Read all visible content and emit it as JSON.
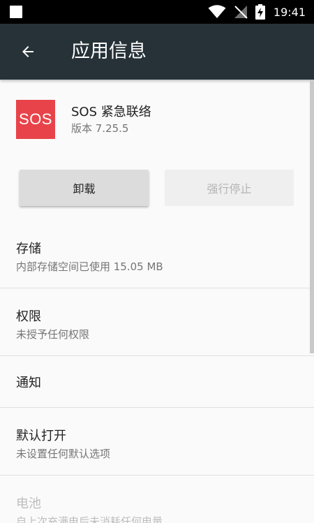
{
  "status_bar": {
    "time": "19:41"
  },
  "app_bar": {
    "title": "应用信息"
  },
  "app": {
    "icon_text": "SOS",
    "name": "SOS 紧急联络",
    "version": "版本 7.25.5",
    "icon_color": "#e8434a"
  },
  "actions": {
    "uninstall_label": "卸载",
    "force_stop_label": "强行停止"
  },
  "settings": [
    {
      "title": "存储",
      "subtitle": "内部存储空间已使用 15.05 MB"
    },
    {
      "title": "权限",
      "subtitle": "未授予任何权限"
    },
    {
      "title": "通知"
    },
    {
      "title": "默认打开",
      "subtitle": "未设置任何默认选项"
    },
    {
      "title": "电池",
      "subtitle": "自上次充满电后未消耗任何电量"
    }
  ],
  "colors": {
    "app_bar": "#263238",
    "status_bar": "#000000",
    "background": "#fafafa"
  }
}
